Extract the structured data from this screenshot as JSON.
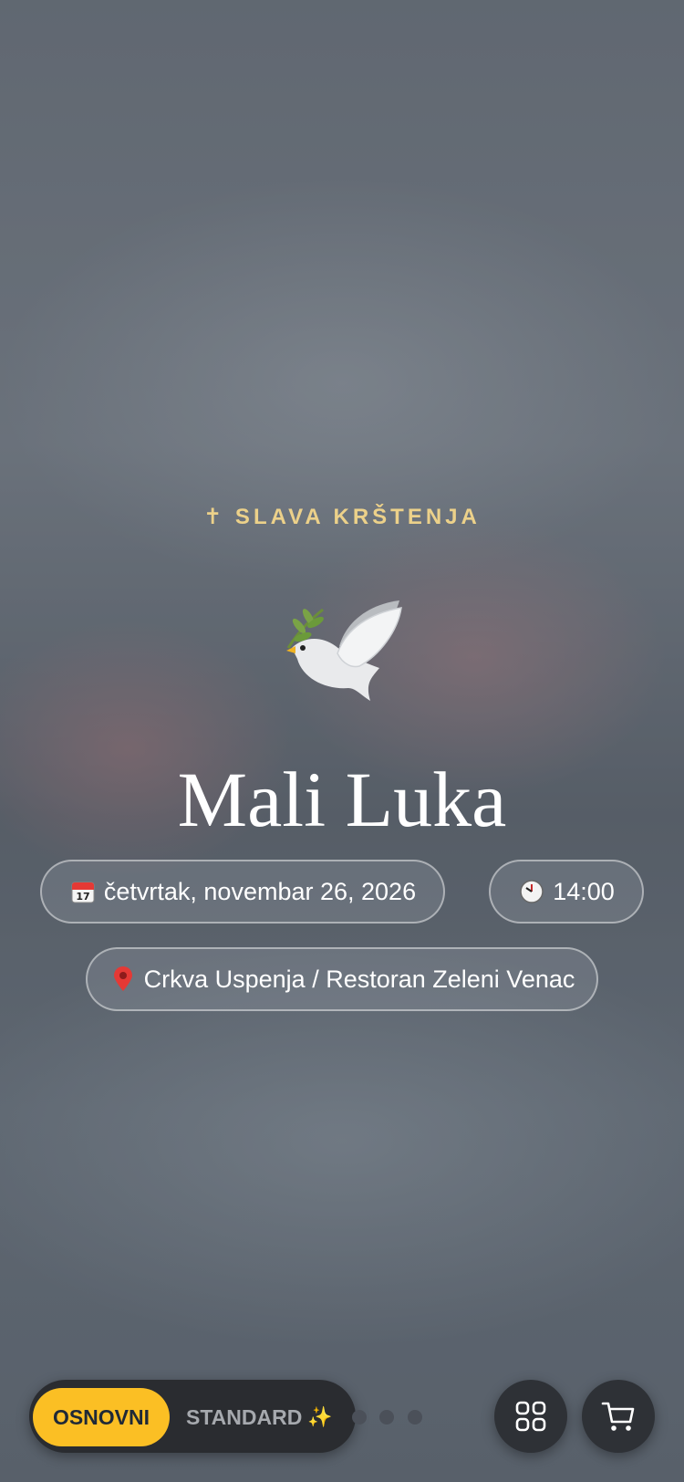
{
  "header": {
    "eyebrow": "✝ SLAVA KRŠTENJA"
  },
  "hero": {
    "icon": "dove-icon",
    "title": "Mali Luka"
  },
  "details": {
    "date": "četvrtak, novembar 26, 2026",
    "time": "14:00",
    "location": "Crkva Uspenja / Restoran Zeleni Venac"
  },
  "switcher": {
    "active_label": "OSNOVNI",
    "inactive_label": "STANDARD",
    "selected": "OSNOVNI"
  },
  "pagination": {
    "dot_count": 3
  },
  "actions": {
    "grid": "grid-icon",
    "cart": "cart-icon"
  },
  "colors": {
    "accent": "#fbbf24",
    "eyebrow": "#ecd18a",
    "dark": "#2a2c30"
  }
}
